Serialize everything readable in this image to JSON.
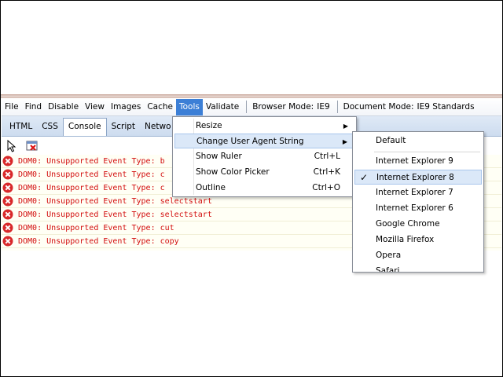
{
  "menubar": {
    "items": [
      "File",
      "Find",
      "Disable",
      "View",
      "Images",
      "Cache",
      "Tools",
      "Validate"
    ],
    "browser_mode_label": "Browser Mode:",
    "browser_mode_value": "IE9",
    "document_mode_label": "Document Mode:",
    "document_mode_value": "IE9 Standards"
  },
  "tabs": [
    "HTML",
    "CSS",
    "Console",
    "Script",
    "Netwo"
  ],
  "console": {
    "rows": [
      "DOM0: Unsupported Event Type: b",
      "DOM0: Unsupported Event Type: c",
      "DOM0: Unsupported Event Type: c",
      "DOM0: Unsupported Event Type: selectstart",
      "DOM0: Unsupported Event Type: selectstart",
      "DOM0: Unsupported Event Type: cut",
      "DOM0: Unsupported Event Type: copy"
    ]
  },
  "tools_menu": {
    "items": [
      {
        "label": "Resize",
        "shortcut": "",
        "submenu": true
      },
      {
        "label": "Change User Agent String",
        "shortcut": "",
        "submenu": true
      },
      {
        "label": "Show Ruler",
        "shortcut": "Ctrl+L",
        "submenu": false
      },
      {
        "label": "Show Color Picker",
        "shortcut": "Ctrl+K",
        "submenu": false
      },
      {
        "label": "Outline",
        "shortcut": "Ctrl+O",
        "submenu": false
      }
    ]
  },
  "ua_menu": {
    "items": [
      "Default",
      "Internet Explorer 9",
      "Internet Explorer 8",
      "Internet Explorer 7",
      "Internet Explorer 6",
      "Google Chrome",
      "Mozilla Firefox",
      "Opera",
      "Safari"
    ],
    "checked": "Internet Explorer 8"
  },
  "colors": {
    "accent": "#3c7fd6",
    "error_text": "#d30f0f",
    "highlight": "#dbe8f8",
    "console_bg": "#fffff5"
  }
}
